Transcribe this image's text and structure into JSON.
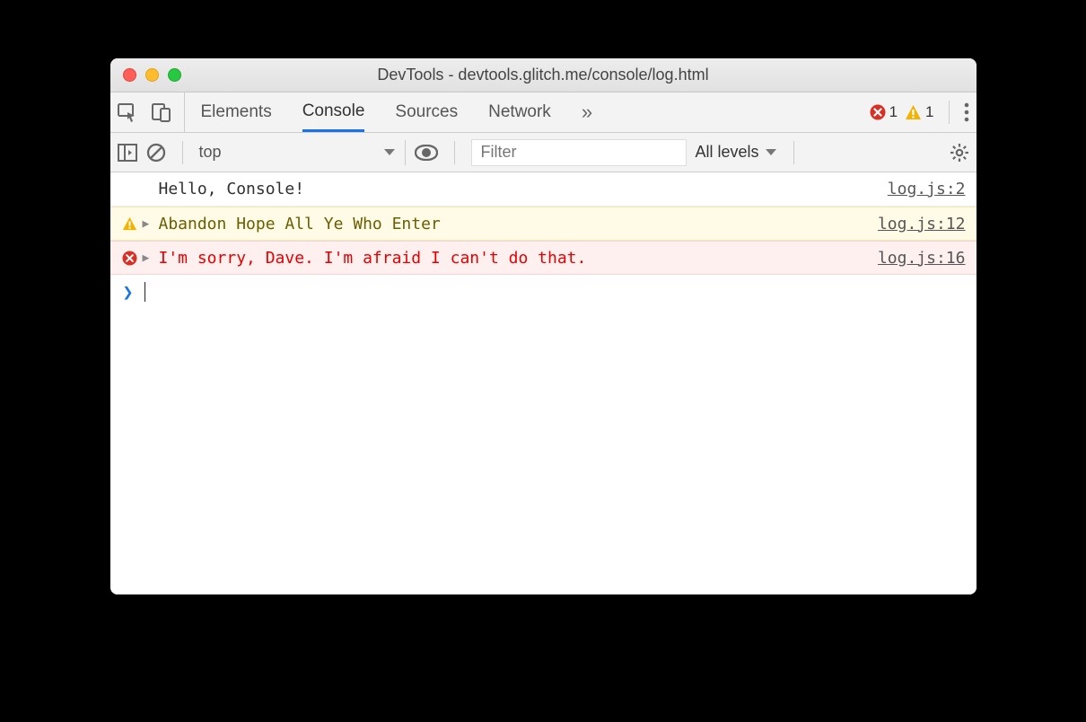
{
  "window": {
    "title": "DevTools - devtools.glitch.me/console/log.html"
  },
  "tabs": {
    "items": [
      "Elements",
      "Console",
      "Sources",
      "Network"
    ],
    "active": 1,
    "overflow_glyph": "»"
  },
  "status": {
    "error_count": "1",
    "warning_count": "1"
  },
  "toolbar": {
    "context": "top",
    "filter_placeholder": "Filter",
    "levels_label": "All levels"
  },
  "console": {
    "messages": [
      {
        "level": "log",
        "expandable": false,
        "text": "Hello, Console!",
        "source": "log.js:2"
      },
      {
        "level": "warn",
        "expandable": true,
        "text": "Abandon Hope All Ye Who Enter",
        "source": "log.js:12"
      },
      {
        "level": "error",
        "expandable": true,
        "text": "I'm sorry, Dave. I'm afraid I can't do that.",
        "source": "log.js:16"
      }
    ]
  }
}
